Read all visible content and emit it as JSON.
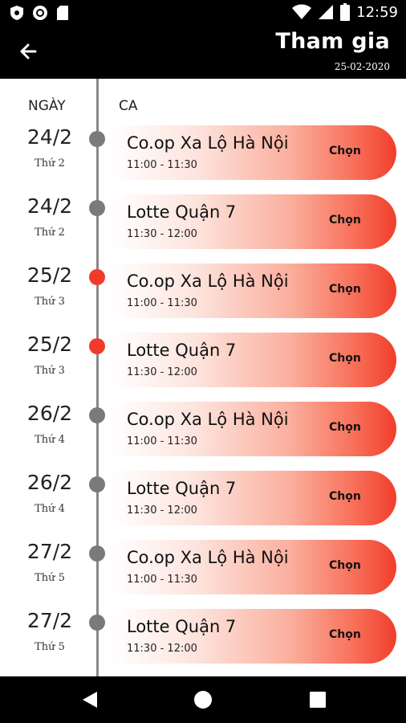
{
  "status_bar": {
    "time": "12:59"
  },
  "app_bar": {
    "title": "Tham gia",
    "date": "25-02-2020"
  },
  "columns": {
    "day_header": "NGÀY",
    "shift_header": "CA"
  },
  "shifts": [
    {
      "day": "24/2",
      "weekday": "Thứ 2",
      "store": "Co.op Xa Lộ Hà Nội",
      "time": "11:00 - 11:30",
      "action": "Chọn",
      "active": false
    },
    {
      "day": "24/2",
      "weekday": "Thứ 2",
      "store": "Lotte Quận 7",
      "time": "11:30 - 12:00",
      "action": "Chọn",
      "active": false
    },
    {
      "day": "25/2",
      "weekday": "Thứ 3",
      "store": "Co.op Xa Lộ Hà Nội",
      "time": "11:00 - 11:30",
      "action": "Chọn",
      "active": true
    },
    {
      "day": "25/2",
      "weekday": "Thứ 3",
      "store": "Lotte Quận 7",
      "time": "11:30 - 12:00",
      "action": "Chọn",
      "active": true
    },
    {
      "day": "26/2",
      "weekday": "Thứ 4",
      "store": "Co.op Xa Lộ Hà Nội",
      "time": "11:00 - 11:30",
      "action": "Chọn",
      "active": false
    },
    {
      "day": "26/2",
      "weekday": "Thứ 4",
      "store": "Lotte Quận 7",
      "time": "11:30 - 12:00",
      "action": "Chọn",
      "active": false
    },
    {
      "day": "27/2",
      "weekday": "Thứ 5",
      "store": "Co.op Xa Lộ Hà Nội",
      "time": "11:00 - 11:30",
      "action": "Chọn",
      "active": false
    },
    {
      "day": "27/2",
      "weekday": "Thứ 5",
      "store": "Lotte Quận 7",
      "time": "11:30 - 12:00",
      "action": "Chọn",
      "active": false
    }
  ],
  "colors": {
    "accent": "#f03e2b",
    "timeline": "#7a7a7a",
    "active_dot": "#f23a2a"
  },
  "icons": {
    "back": "arrow-left-icon",
    "nav_back": "triangle-back-icon",
    "nav_home": "circle-home-icon",
    "nav_recents": "square-recents-icon"
  }
}
